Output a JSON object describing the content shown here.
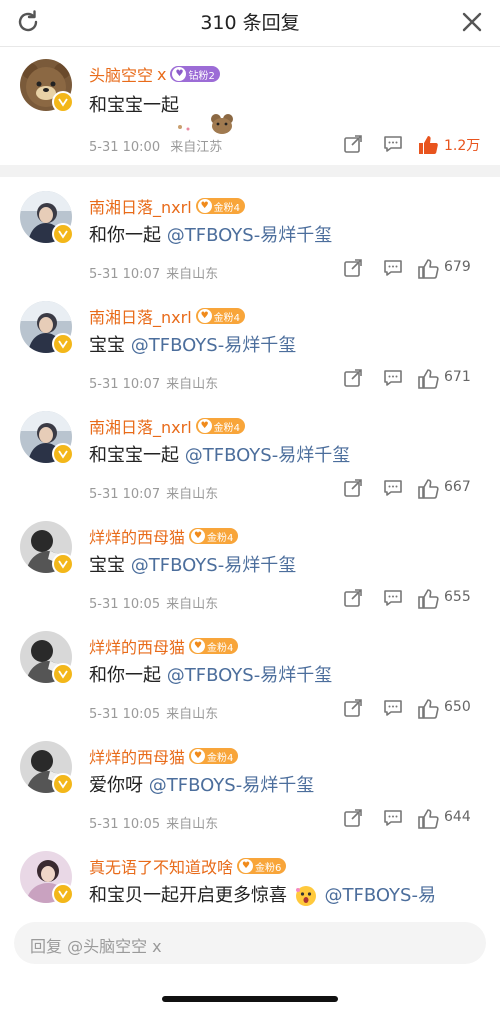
{
  "header": {
    "title": "310 条回复",
    "refresh_icon": "refresh-icon",
    "close_icon": "close-icon"
  },
  "pinned": {
    "name": "头脑空空",
    "name_suffix": "x",
    "badge": "钻粉2",
    "content": "和宝宝一起",
    "time": "5-31 10:00",
    "location": "来自江苏",
    "likes": "1.2万",
    "avatar": "bear-avatar"
  },
  "comments": [
    {
      "name": "南湘日落_nxrl",
      "badge": "金粉4",
      "text": "和你一起 ",
      "mention": "@TFBOYS-易烊千玺",
      "time": "5-31 10:07",
      "location": "来自山东",
      "likes": "679"
    },
    {
      "name": "南湘日落_nxrl",
      "badge": "金粉4",
      "text": "宝宝 ",
      "mention": "@TFBOYS-易烊千玺",
      "time": "5-31 10:07",
      "location": "来自山东",
      "likes": "671"
    },
    {
      "name": "南湘日落_nxrl",
      "badge": "金粉4",
      "text": "和宝宝一起 ",
      "mention": "@TFBOYS-易烊千玺",
      "time": "5-31 10:07",
      "location": "来自山东",
      "likes": "667"
    },
    {
      "name": "烊烊的西母猫",
      "badge": "金粉4",
      "text": "宝宝 ",
      "mention": "@TFBOYS-易烊千玺",
      "time": "5-31 10:05",
      "location": "来自山东",
      "likes": "655"
    },
    {
      "name": "烊烊的西母猫",
      "badge": "金粉4",
      "text": "和你一起 ",
      "mention": "@TFBOYS-易烊千玺",
      "time": "5-31 10:05",
      "location": "来自山东",
      "likes": "650"
    },
    {
      "name": "烊烊的西母猫",
      "badge": "金粉4",
      "text": "爱你呀 ",
      "mention": "@TFBOYS-易烊千玺",
      "time": "5-31 10:05",
      "location": "来自山东",
      "likes": "644"
    },
    {
      "name": "真无语了不知道改啥",
      "badge": "金粉6",
      "text": "和宝贝一起开启更多惊喜",
      "mention": "@TFBOYS-易",
      "time": "",
      "location": "",
      "likes": ""
    }
  ],
  "reply_bar": {
    "placeholder": "回复 @头脑空空 x"
  },
  "colors": {
    "name": "#e86b1a",
    "mention": "#4c6e9c",
    "like_hot": "#e8541e",
    "meta": "#9a9a9a"
  }
}
